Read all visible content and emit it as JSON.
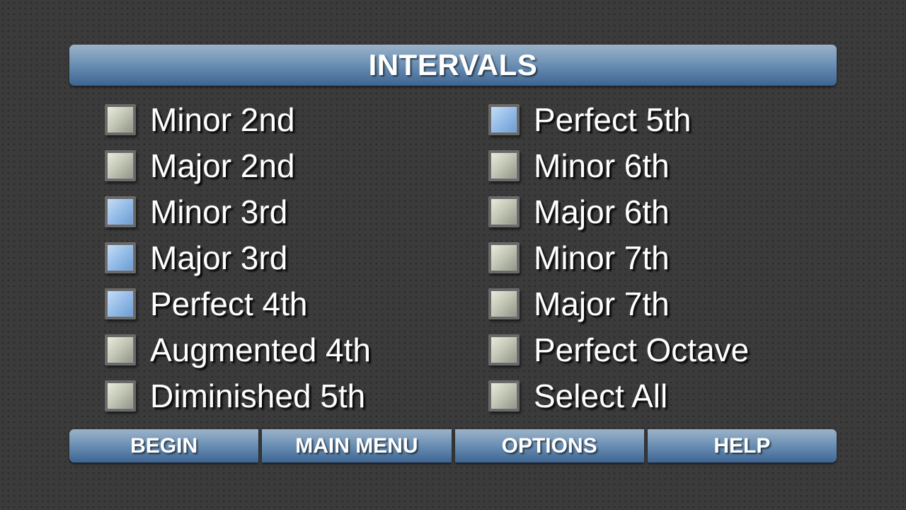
{
  "header": {
    "title": "INTERVALS"
  },
  "intervals": {
    "left": [
      {
        "label": "Minor 2nd",
        "checked": false
      },
      {
        "label": "Major 2nd",
        "checked": false
      },
      {
        "label": "Minor 3rd",
        "checked": true
      },
      {
        "label": "Major 3rd",
        "checked": true
      },
      {
        "label": "Perfect 4th",
        "checked": true
      },
      {
        "label": "Augmented 4th",
        "checked": false
      },
      {
        "label": "Diminished 5th",
        "checked": false
      }
    ],
    "right": [
      {
        "label": "Perfect 5th",
        "checked": true
      },
      {
        "label": "Minor 6th",
        "checked": false
      },
      {
        "label": "Major 6th",
        "checked": false
      },
      {
        "label": "Minor 7th",
        "checked": false
      },
      {
        "label": "Major 7th",
        "checked": false
      },
      {
        "label": "Perfect Octave",
        "checked": false
      },
      {
        "label": "Select All",
        "checked": false
      }
    ]
  },
  "buttons": {
    "begin": "BEGIN",
    "main_menu": "MAIN MENU",
    "options": "OPTIONS",
    "help": "HELP"
  },
  "colors": {
    "accent_blue": "#6e92b6",
    "checked_blue": "#94bce8",
    "unchecked_gray": "#c4c8b6",
    "background": "#3b3b3b"
  }
}
